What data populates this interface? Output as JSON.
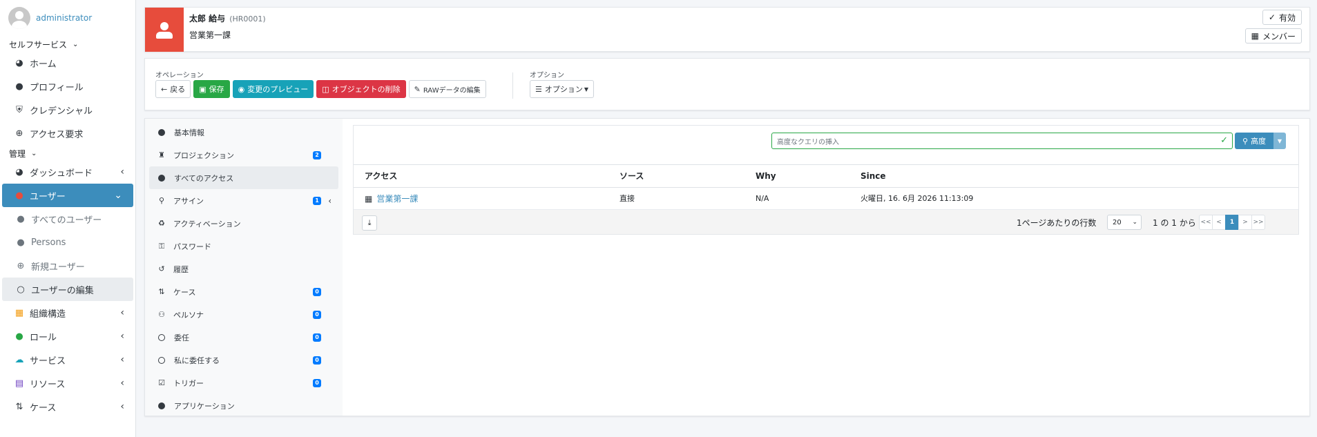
{
  "user": {
    "name": "administrator"
  },
  "sidebar": {
    "selfservice_header": "セルフサービス",
    "selfservice_items": [
      {
        "label": "ホーム",
        "icon": "dashboard-icon"
      },
      {
        "label": "プロフィール",
        "icon": "user-icon"
      },
      {
        "label": "クレデンシャル",
        "icon": "shield-icon"
      },
      {
        "label": "アクセス要求",
        "icon": "plus-circle-icon"
      }
    ],
    "admin_header": "管理",
    "admin_items": {
      "dashboard": "ダッシュボード",
      "users": "ユーザー",
      "all_users": "すべてのユーザー",
      "persons": "Persons",
      "new_user": "新規ユーザー",
      "edit_user": "ユーザーの編集",
      "org": "組織構造",
      "role": "ロール",
      "service": "サービス",
      "resource": "リソース",
      "case": "ケース"
    }
  },
  "header": {
    "title": "太郎 給与",
    "id": "(HR0001)",
    "subtitle": "営業第一課",
    "status_label": "有効",
    "member_label": "メンバー"
  },
  "operations": {
    "label": "オペレーション",
    "back": "戻る",
    "save": "保存",
    "preview": "変更のプレビュー",
    "delete": "オブジェクトの削除",
    "raw": "RAWデータの編集",
    "options_label": "オプション",
    "options_btn": "オプション"
  },
  "inner_nav": [
    {
      "label": "基本情報",
      "icon": "circle-icon"
    },
    {
      "label": "プロジェクション",
      "icon": "person-icon",
      "badge": "2"
    },
    {
      "label": "すべてのアクセス",
      "icon": "circle-icon"
    },
    {
      "label": "アサイン",
      "icon": "key-assign-icon",
      "badge": "1"
    },
    {
      "label": "アクティベーション",
      "icon": "recycle-icon"
    },
    {
      "label": "パスワード",
      "icon": "key-icon"
    },
    {
      "label": "履歴",
      "icon": "history-icon"
    },
    {
      "label": "ケース",
      "icon": "case-icon",
      "badge": "0"
    },
    {
      "label": "ペルソナ",
      "icon": "users-icon",
      "badge": "0"
    },
    {
      "label": "委任",
      "icon": "ring-icon",
      "badge": "0"
    },
    {
      "label": "私に委任する",
      "icon": "ring-icon",
      "badge": "0"
    },
    {
      "label": "トリガー",
      "icon": "calendar-icon",
      "badge": "0"
    },
    {
      "label": "アプリケーション",
      "icon": "circle-icon"
    }
  ],
  "search": {
    "placeholder": "高度なクエリの挿入",
    "button": "高度"
  },
  "table": {
    "headers": [
      "アクセス",
      "ソース",
      "Why",
      "Since"
    ],
    "rows": [
      {
        "access": "営業第一課",
        "source": "直接",
        "why": "N/A",
        "since": "火曜日, 16. 6月 2026 11:13:09"
      }
    ]
  },
  "footer": {
    "rows_label": "1ページあたりの行数",
    "rows_value": "20",
    "range": "1 の 1 から 1",
    "pager": [
      "<<",
      "<",
      "1",
      ">",
      ">>"
    ]
  },
  "colors": {
    "accent": "#3c8dbc",
    "header_icon": "#e74c3c",
    "save": "#28a745",
    "preview": "#17a2b8",
    "delete": "#dc3545"
  }
}
